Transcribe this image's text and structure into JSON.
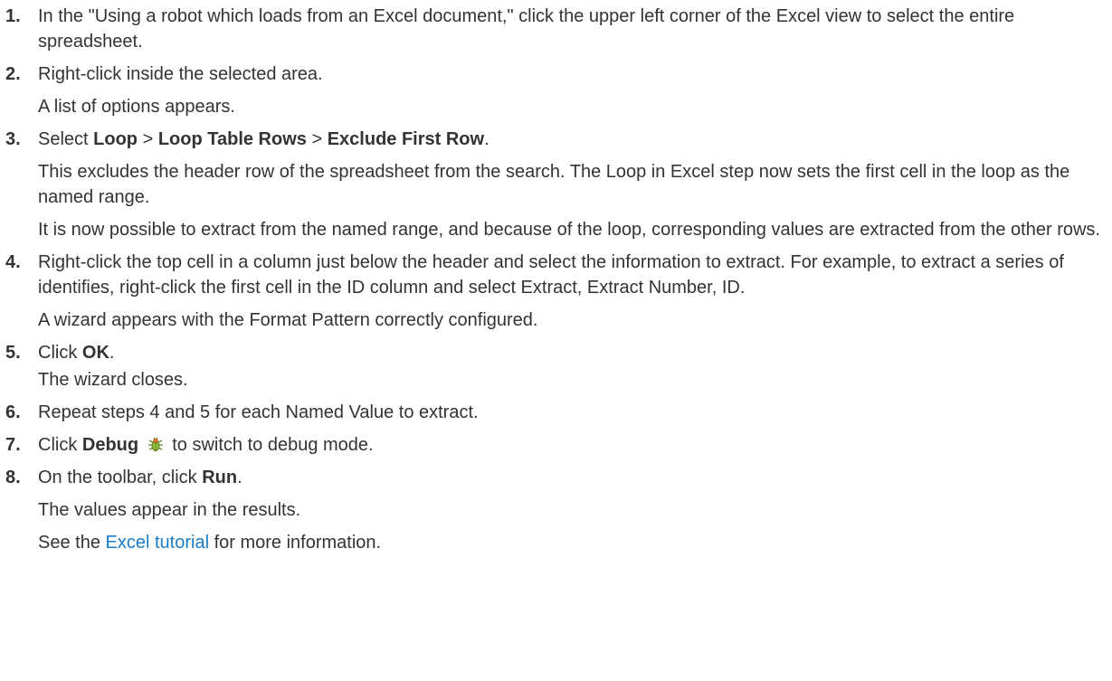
{
  "steps": [
    {
      "number": "1.",
      "text": "In the \"Using a robot which loads from an Excel document,\" click the upper left corner of the Excel view to select the entire spreadsheet."
    },
    {
      "number": "2.",
      "text": "Right-click inside the selected area.",
      "result": "A list of options appears."
    },
    {
      "number": "3.",
      "text_prefix": "Select ",
      "menu": [
        "Loop",
        "Loop Table Rows",
        "Exclude First Row"
      ],
      "separator": " > ",
      "text_suffix": ".",
      "paragraphs": [
        "This excludes the header row of the spreadsheet from the search. The Loop in Excel step now sets the first cell in the loop as the named range.",
        "It is now possible to extract from the named range, and because of the loop, corresponding values are extracted from the other rows."
      ]
    },
    {
      "number": "4.",
      "text": "Right-click the top cell in a column just below the header and select the information to extract. For example, to extract a series of identifies, right-click the first cell in the ID column and select Extract, Extract Number, ID.",
      "result": "A wizard appears with the Format Pattern correctly configured."
    },
    {
      "number": "5.",
      "text_prefix": "Click ",
      "bold": "OK",
      "text_suffix": ".",
      "result": "The wizard closes."
    },
    {
      "number": "6.",
      "text": "Repeat steps 4 and 5 for each Named Value to extract."
    },
    {
      "number": "7.",
      "text_prefix": "Click ",
      "bold": "Debug",
      "icon": "debug-bug-icon",
      "text_suffix": " to switch to debug mode."
    },
    {
      "number": "8.",
      "text_prefix": "On the toolbar, click ",
      "bold": "Run",
      "text_suffix": ".",
      "result": "The values appear in the results.",
      "see_prefix": "See the ",
      "link": "Excel tutorial",
      "see_suffix": " for more information."
    }
  ],
  "colors": {
    "text": "#333333",
    "link": "#1a7cc4"
  }
}
